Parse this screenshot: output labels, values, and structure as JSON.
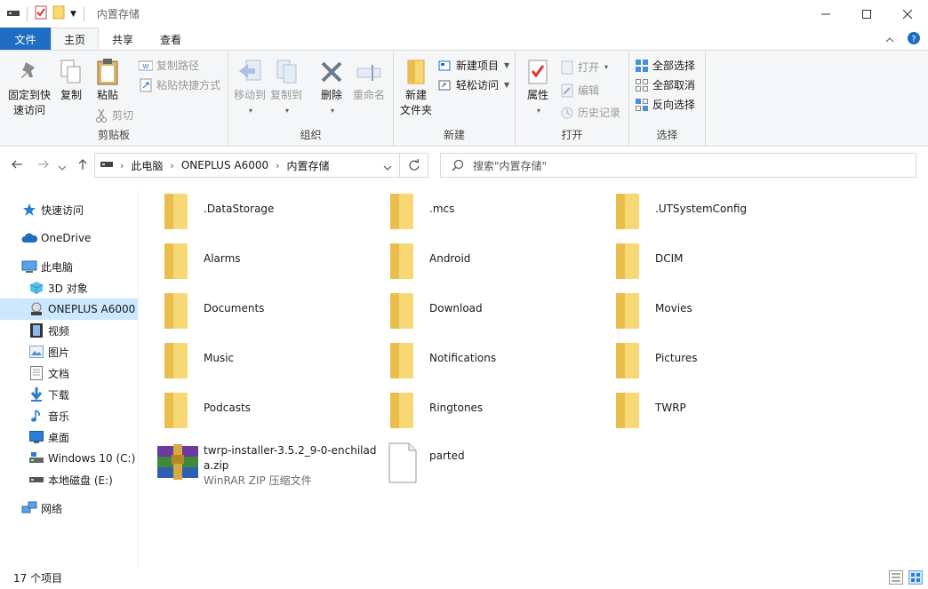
{
  "window": {
    "title": "内置存储"
  },
  "ribbon_tabs": [
    "文件",
    "主页",
    "共享",
    "查看"
  ],
  "ribbon": {
    "clipboard": {
      "pin_label_1": "固定到快",
      "pin_label_2": "速访问",
      "copy": "复制",
      "paste": "粘贴",
      "copy_path": "复制路径",
      "paste_shortcut": "粘贴快捷方式",
      "cut": "剪切",
      "group": "剪贴板"
    },
    "organize": {
      "move_to": "移动到",
      "copy_to": "复制到",
      "delete": "删除",
      "rename": "重命名",
      "group": "组织"
    },
    "new": {
      "new_folder_1": "新建",
      "new_folder_2": "文件夹",
      "new_item": "新建项目",
      "easy_access": "轻松访问",
      "group": "新建"
    },
    "open": {
      "properties": "属性",
      "open": "打开",
      "edit": "编辑",
      "history": "历史记录",
      "group": "打开"
    },
    "select": {
      "select_all": "全部选择",
      "select_none": "全部取消",
      "invert": "反向选择",
      "group": "选择"
    }
  },
  "address": {
    "crumbs": [
      "此电脑",
      "ONEPLUS A6000",
      "内置存储"
    ],
    "search_placeholder": "搜索\"内置存储\""
  },
  "sidebar": [
    {
      "label": "快速访问",
      "icon": "star-icon"
    },
    {
      "label": "OneDrive",
      "icon": "cloud-icon"
    },
    {
      "label": "此电脑",
      "icon": "computer-icon"
    },
    {
      "label": "3D 对象",
      "icon": "cube-icon"
    },
    {
      "label": "ONEPLUS A6000",
      "icon": "device-icon",
      "selected": true
    },
    {
      "label": "视频",
      "icon": "video-icon"
    },
    {
      "label": "图片",
      "icon": "picture-icon"
    },
    {
      "label": "文档",
      "icon": "document-icon"
    },
    {
      "label": "下载",
      "icon": "download-icon"
    },
    {
      "label": "音乐",
      "icon": "music-icon"
    },
    {
      "label": "桌面",
      "icon": "desktop-icon"
    },
    {
      "label": "Windows 10 (C:)",
      "icon": "drive-icon"
    },
    {
      "label": "本地磁盘 (E:)",
      "icon": "drive-icon"
    },
    {
      "label": "网络",
      "icon": "network-icon"
    }
  ],
  "files": [
    {
      "name": ".DataStorage",
      "type": "folder"
    },
    {
      "name": ".mcs",
      "type": "folder"
    },
    {
      "name": ".UTSystemConfig",
      "type": "folder"
    },
    {
      "name": "Alarms",
      "type": "folder"
    },
    {
      "name": "Android",
      "type": "folder"
    },
    {
      "name": "DCIM",
      "type": "folder"
    },
    {
      "name": "Documents",
      "type": "folder"
    },
    {
      "name": "Download",
      "type": "folder"
    },
    {
      "name": "Movies",
      "type": "folder"
    },
    {
      "name": "Music",
      "type": "folder"
    },
    {
      "name": "Notifications",
      "type": "folder"
    },
    {
      "name": "Pictures",
      "type": "folder"
    },
    {
      "name": "Podcasts",
      "type": "folder"
    },
    {
      "name": "Ringtones",
      "type": "folder"
    },
    {
      "name": "TWRP",
      "type": "folder"
    },
    {
      "name_line1": "twrp-installer-3.5.2_9-0-enchilad",
      "name_line2": "a.zip",
      "subtitle": "WinRAR ZIP 压缩文件",
      "type": "zip"
    },
    {
      "name": "parted",
      "type": "file"
    }
  ],
  "status": {
    "count": "17 个项目"
  },
  "colors": {
    "accent": "#1e6dc2",
    "folder": "#f8d775",
    "selected": "#cce8ff"
  }
}
